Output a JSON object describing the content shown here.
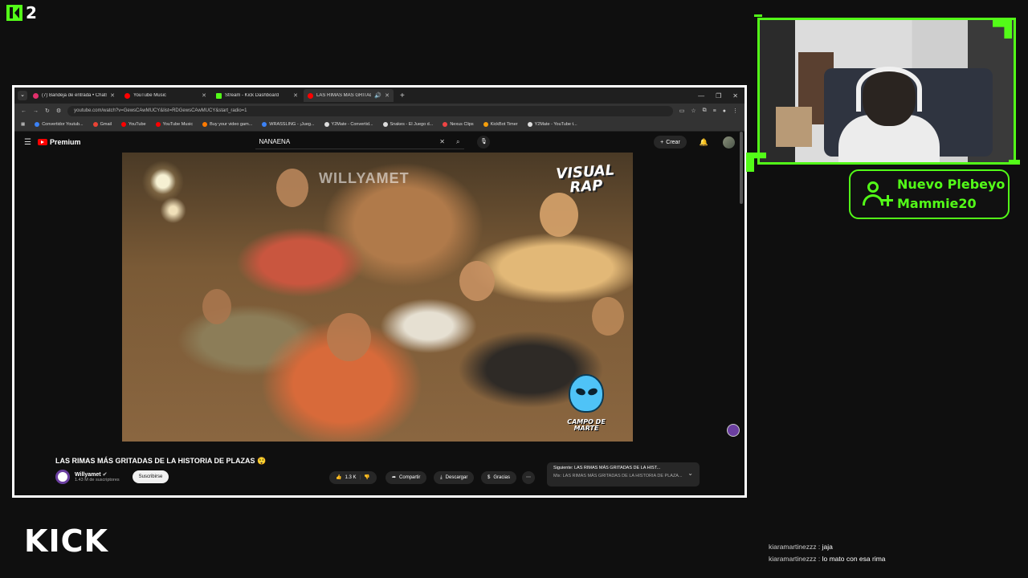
{
  "overlay": {
    "logo_text": "2",
    "wordmark": "KICK",
    "accent_color": "#53fc18"
  },
  "browser": {
    "tabs": [
      {
        "label": "(7) Bandeja de entrada • Chats",
        "favicon_color": "#e1306c",
        "active": false
      },
      {
        "label": "YouTube Music",
        "favicon_color": "#ff0000",
        "active": false
      },
      {
        "label": "Stream - Kick Dashboard",
        "favicon_color": "#53fc18",
        "active": false
      },
      {
        "label": "LAS RIMAS MÁS GRITADAS",
        "favicon_color": "#ff0000",
        "active": true
      }
    ],
    "url": "youtube.com/watch?v=GewsCAwMUCY&list=RDGewsCAwMUCY&start_radio=1",
    "bookmarks": [
      {
        "label": "Convertidor Youtub...",
        "color": "#3b82f6"
      },
      {
        "label": "Gmail",
        "color": "#ea4335"
      },
      {
        "label": "YouTube",
        "color": "#ff0000"
      },
      {
        "label": "YouTube Music",
        "color": "#ff0000"
      },
      {
        "label": "Buy your video gam...",
        "color": "#ff7a00"
      },
      {
        "label": "WRASSLING - ¡Jueg...",
        "color": "#3b82f6"
      },
      {
        "label": "Y2Mate - Convertid...",
        "color": "#dddddd"
      },
      {
        "label": "Snakes - El Juego d...",
        "color": "#dddddd"
      },
      {
        "label": "Nexus Clips",
        "color": "#ef4444"
      },
      {
        "label": "KickBot Timer",
        "color": "#f59e0b"
      },
      {
        "label": "Y2Mate - YouTube t...",
        "color": "#dddddd"
      }
    ]
  },
  "youtube": {
    "logo_label": "Premium",
    "search_query": "NANAENA",
    "create_label": "Crear",
    "video": {
      "watermark": "WILLYAMET",
      "visual_rap_line1": "VISUAL",
      "visual_rap_line2": "RAP",
      "brand_logo_text": "CAMPO DE MARTE"
    },
    "title": "LAS RIMAS MÁS GRITADAS DE LA HISTORIA DE PLAZAS 😲",
    "channel_name": "Willyamet",
    "subscribers": "1.43 M de suscriptores",
    "subscribe_label": "Suscribirse",
    "likes": "1.3 K",
    "share_label": "Compartir",
    "download_label": "Descargar",
    "thanks_label": "Gracias",
    "next_line1": "Siguiente: LAS RIMAS MÁS GRITADAS DE LA HIST...",
    "next_line2": "Mix: LAS RIMAS MÁS GRITADAS DE LA HISTORIA DE PLAZA..."
  },
  "alert": {
    "title": "Nuevo Plebeyo",
    "username": "Mammie20"
  },
  "chat": [
    {
      "user": "kiaramartinezzz",
      "message": "jaja"
    },
    {
      "user": "kiaramartinezzz",
      "message": "lo mato con esa rima"
    }
  ]
}
